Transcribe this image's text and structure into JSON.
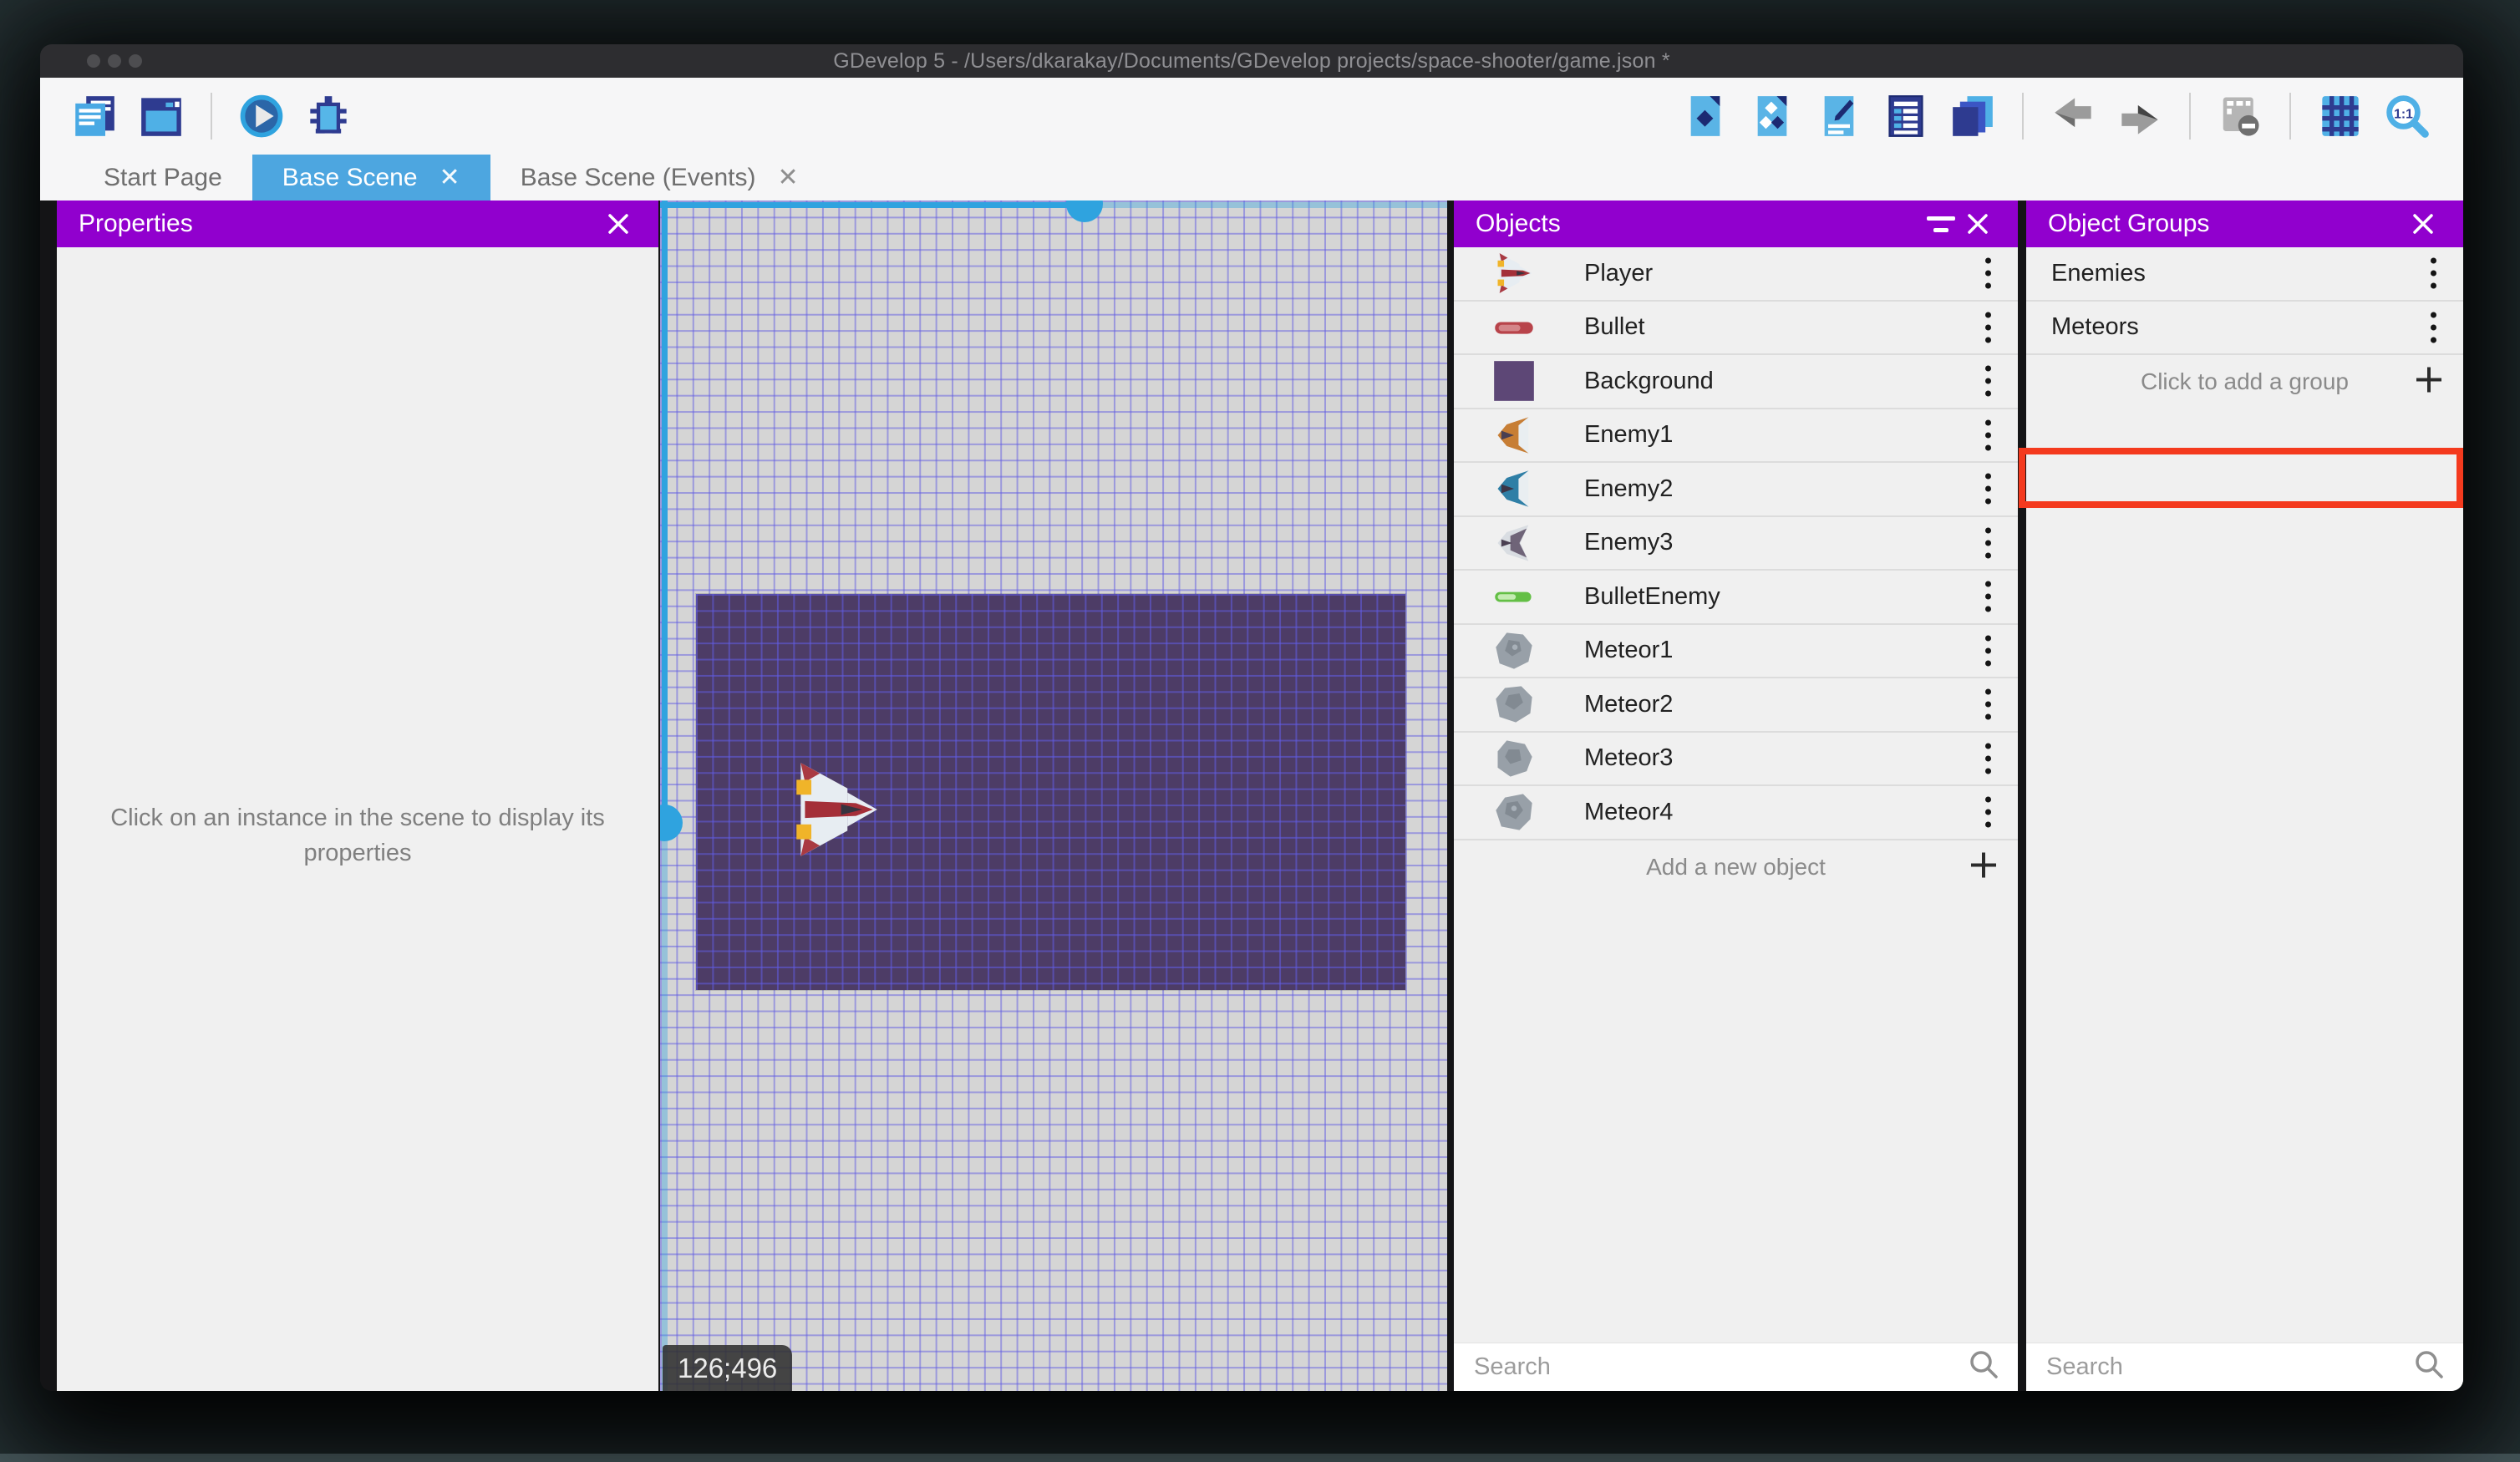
{
  "window": {
    "title": "GDevelop 5 - /Users/dkarakay/Documents/GDevelop projects/space-shooter/game.json *"
  },
  "toolbar": {
    "left_icons": [
      "project-manager-icon",
      "scene-editor-icon",
      "play-icon",
      "debug-icon"
    ],
    "right_icons": [
      "objects-panel-icon",
      "object-groups-panel-icon",
      "properties-panel-icon",
      "instances-list-icon",
      "layers-panel-icon",
      "undo-icon",
      "redo-icon",
      "window-mask-icon",
      "grid-icon",
      "zoom-one-to-one-icon"
    ]
  },
  "tabs": {
    "items": [
      {
        "label": "Start Page",
        "active": false
      },
      {
        "label": "Base Scene",
        "active": true
      },
      {
        "label": "Base Scene (Events)",
        "active": false
      }
    ]
  },
  "scene": {
    "coordinates": "126;496"
  },
  "panels": {
    "properties": {
      "title": "Properties",
      "empty_message": "Click on an instance in the scene to display its properties"
    },
    "objects": {
      "title": "Objects",
      "items": [
        {
          "label": "Player",
          "icon": "player-sprite-icon"
        },
        {
          "label": "Bullet",
          "icon": "bullet-sprite-icon"
        },
        {
          "label": "Background",
          "icon": "background-sprite-icon"
        },
        {
          "label": "Enemy1",
          "icon": "enemy1-sprite-icon"
        },
        {
          "label": "Enemy2",
          "icon": "enemy2-sprite-icon"
        },
        {
          "label": "Enemy3",
          "icon": "enemy3-sprite-icon"
        },
        {
          "label": "BulletEnemy",
          "icon": "bullet-enemy-sprite-icon"
        },
        {
          "label": "Meteor1",
          "icon": "meteor-sprite-icon"
        },
        {
          "label": "Meteor2",
          "icon": "meteor-sprite-icon"
        },
        {
          "label": "Meteor3",
          "icon": "meteor-sprite-icon"
        },
        {
          "label": "Meteor4",
          "icon": "meteor-sprite-icon"
        }
      ],
      "add_label": "Add a new object",
      "search_placeholder": "Search"
    },
    "groups": {
      "title": "Object Groups",
      "items": [
        {
          "label": "Enemies",
          "highlighted": false
        },
        {
          "label": "Meteors",
          "highlighted": true
        }
      ],
      "add_label": "Click to add a group",
      "search_placeholder": "Search"
    }
  },
  "colors": {
    "panel_header_purple": "#9100ce",
    "active_tab_blue": "#4da6e0",
    "selection_blue": "#2fa3df",
    "annotation_red": "#f43a1e",
    "scene_background_rect": "#4d3c66"
  }
}
